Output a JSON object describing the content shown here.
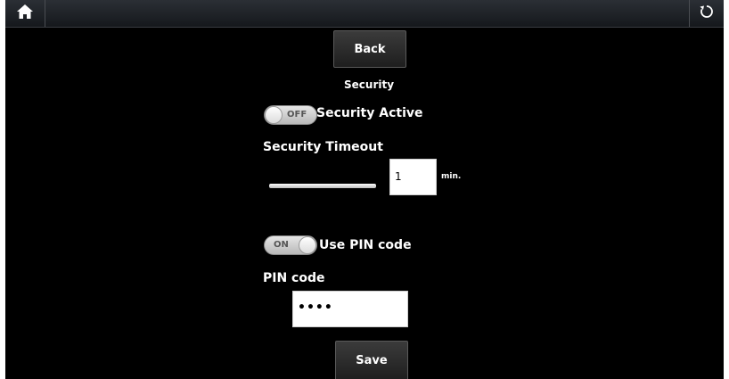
{
  "topbar": {
    "home_icon": "home-icon",
    "refresh_icon": "refresh-icon"
  },
  "nav": {
    "back_label": "Back"
  },
  "page": {
    "title": "Security"
  },
  "security_toggle": {
    "state_label": "OFF",
    "label": "Security Active",
    "on": false
  },
  "timeout": {
    "heading": "Security Timeout",
    "value": "1",
    "unit": "min."
  },
  "pin_toggle": {
    "state_label": "ON",
    "label": "Use PIN code",
    "on": true
  },
  "pin": {
    "heading": "PIN code",
    "value": "••••"
  },
  "actions": {
    "save_label": "Save"
  },
  "colors": {
    "background": "#000000",
    "text": "#ffffff"
  }
}
